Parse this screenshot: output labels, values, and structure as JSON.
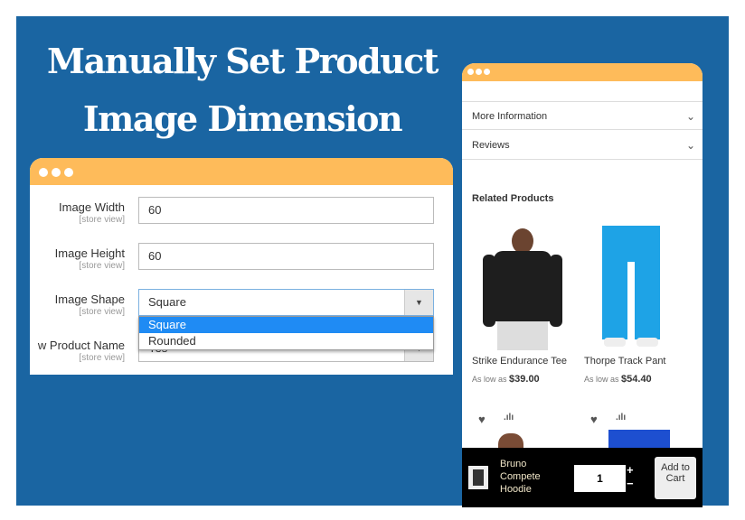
{
  "title": "Manually Set Product Image Dimension",
  "form": {
    "rows": [
      {
        "label": "Image Width",
        "scope": "[store view]",
        "value": "60"
      },
      {
        "label": "Image Height",
        "scope": "[store view]",
        "value": "60"
      },
      {
        "label": "Image Shape",
        "scope": "[store view]",
        "value": "Square"
      },
      {
        "label": "w Product Name",
        "scope": "[store view]",
        "value": "Yes"
      }
    ],
    "options": [
      "Square",
      "Rounded"
    ]
  },
  "store": {
    "accordions": [
      "More Information",
      "Reviews"
    ],
    "related_title": "Related Products",
    "products": [
      {
        "name": "Strike Endurance Tee",
        "as_low": "As low as",
        "price": "$39.00"
      },
      {
        "name": "Thorpe Track Pant",
        "as_low": "As low as",
        "price": "$54.40"
      }
    ],
    "sticky": {
      "name": "Bruno Compete Hoodie",
      "qty": "1",
      "plus": "+",
      "minus": "−",
      "add": "Add to Cart"
    }
  },
  "colors": {
    "background": "#1a65a2",
    "header": "#febb5a",
    "selected": "#1f8bf4"
  }
}
